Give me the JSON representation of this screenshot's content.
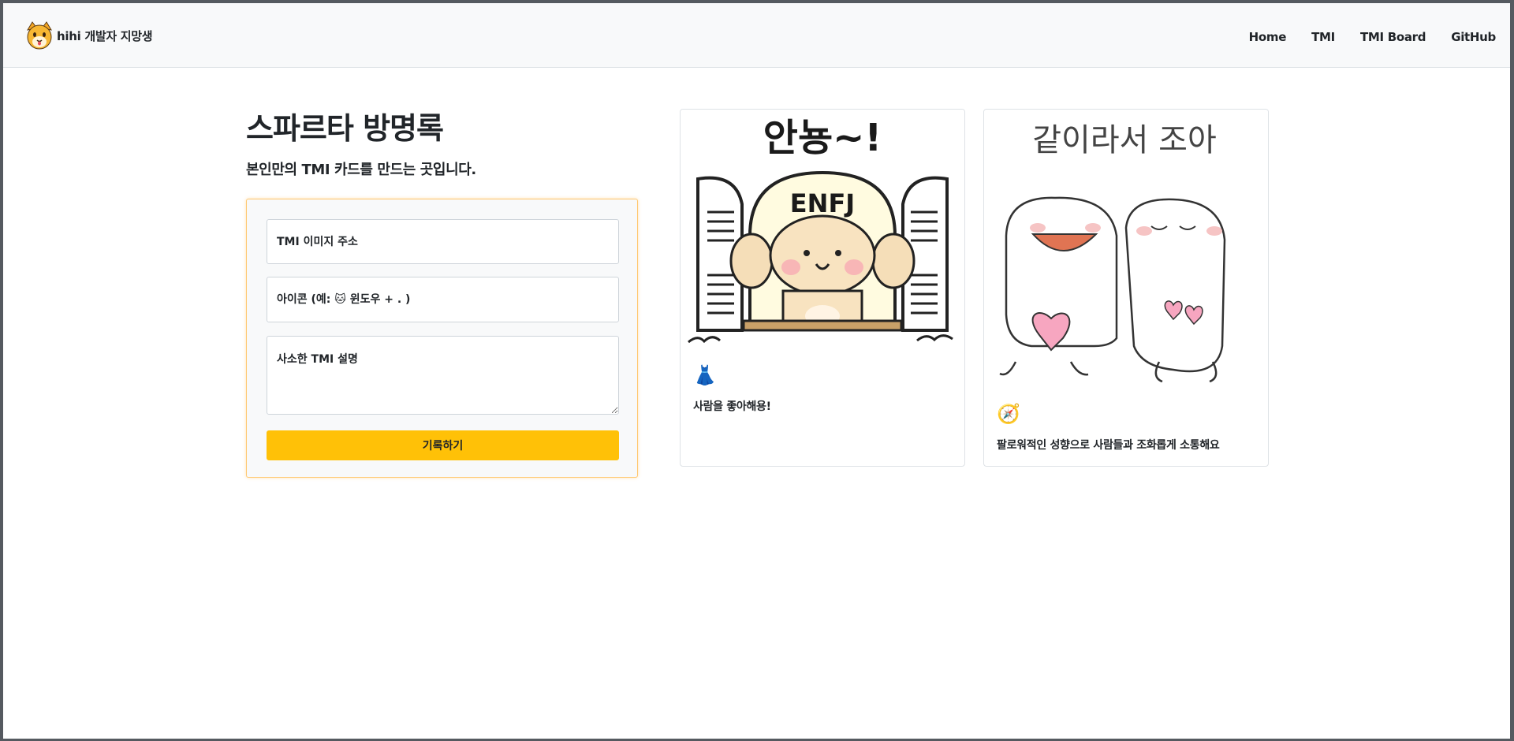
{
  "navbar": {
    "brand": "hihi 개발자 지망생",
    "links": [
      "Home",
      "TMI",
      "TMI Board",
      "GitHub"
    ]
  },
  "main": {
    "title": "스파르타 방명록",
    "subtitle": "본인만의 TMI 카드를 만드는 곳입니다."
  },
  "form": {
    "image_placeholder": "TMI 이미지 주소",
    "icon_placeholder": "아이콘 (예: 🐱 윈도우 + . )",
    "desc_placeholder": "사소한 TMI 설명",
    "submit_label": "기록하기"
  },
  "cards": [
    {
      "image_text": "안뇽~!",
      "image_badge": "ENFJ",
      "icon": "👗",
      "text": "사람을 좋아해용!"
    },
    {
      "image_text": "같이라서 조아",
      "icon": "🧭",
      "text": "팔로워적인 성향으로 사람들과 조화롭게 소통해요"
    }
  ],
  "colors": {
    "accent": "#ffc107",
    "form_border": "#ffc870",
    "navbar_bg": "#f8f9fa"
  }
}
